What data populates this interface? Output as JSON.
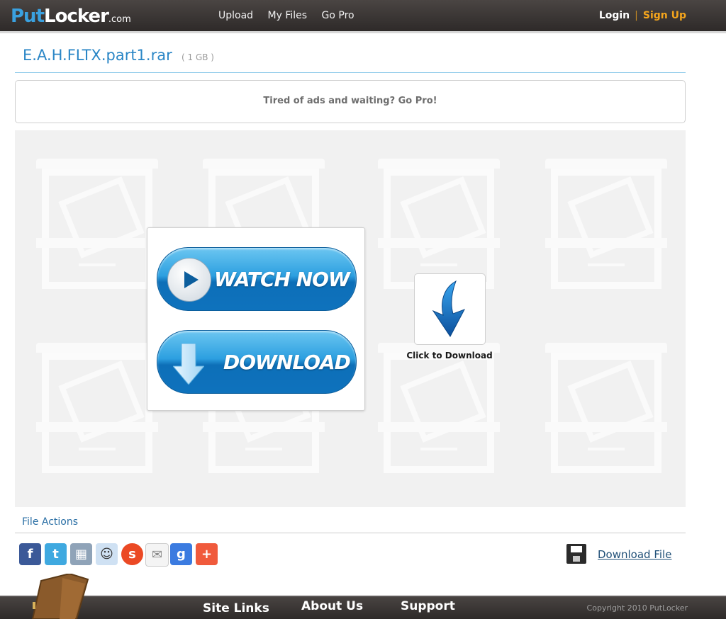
{
  "header": {
    "logo": {
      "put": "Put",
      "locker": "Locker",
      "com": ".com"
    },
    "nav": [
      "Upload",
      "My Files",
      "Go Pro"
    ],
    "login": "Login",
    "separator": "|",
    "signup": "Sign Up"
  },
  "file": {
    "name": "E.A.H.FLTX.part1.rar",
    "size": "( 1 GB )"
  },
  "promo": {
    "text": "Tired of ads and waiting? Go Pro!"
  },
  "buttons": {
    "watch_now": "WATCH NOW",
    "download": "DOWNLOAD",
    "click_to_download": "Click to Download"
  },
  "file_actions": {
    "title": "File Actions",
    "social_icons": [
      "facebook-icon",
      "twitter-icon",
      "myspace-icon",
      "reddit-icon",
      "stumbleupon-icon",
      "email-icon",
      "google-icon",
      "addthis-icon"
    ],
    "download_file": "Download File"
  },
  "footer": {
    "links": [
      "Site Links",
      "About Us",
      "Support"
    ],
    "copyright": "Copyright 2010 PutLocker"
  },
  "colors": {
    "accent_blue": "#2a86c6",
    "signup_orange": "#f4a51c",
    "header_dark": "#3a3635"
  }
}
